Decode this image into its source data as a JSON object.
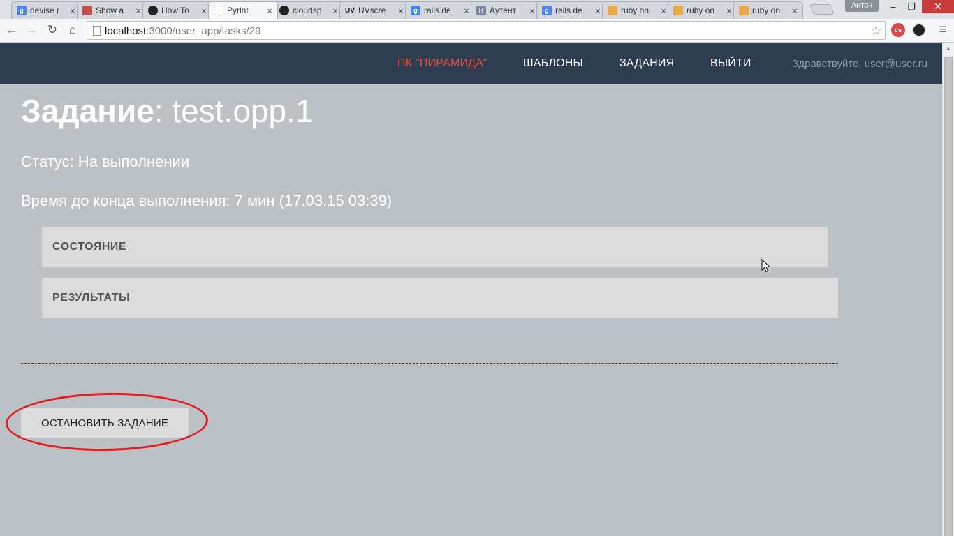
{
  "browser": {
    "tabs": [
      {
        "title": "devise r",
        "favicon": "google-icon",
        "color": "#4a86e8",
        "glyph": "g"
      },
      {
        "title": "Show a",
        "favicon": "image-icon",
        "color": "#c0504d",
        "glyph": ""
      },
      {
        "title": "How To",
        "favicon": "github-icon",
        "color": "#222222",
        "glyph": ""
      },
      {
        "title": "Pyrlnt",
        "favicon": "document-icon",
        "color": "#ffffff",
        "glyph": "",
        "active": true
      },
      {
        "title": "cloudsp",
        "favicon": "github-icon",
        "color": "#222222",
        "glyph": ""
      },
      {
        "title": "UVscre",
        "favicon": "uv-icon",
        "color": "#333333",
        "glyph": "UV"
      },
      {
        "title": "rails de",
        "favicon": "google-icon",
        "color": "#4a86e8",
        "glyph": "g"
      },
      {
        "title": "Аутент",
        "favicon": "habr-icon",
        "color": "#7b8aa0",
        "glyph": "H"
      },
      {
        "title": "rails de",
        "favicon": "google-icon",
        "color": "#4a86e8",
        "glyph": "g"
      },
      {
        "title": "ruby on",
        "favicon": "stackoverflow-icon",
        "color": "#e8a94a",
        "glyph": ""
      },
      {
        "title": "ruby on",
        "favicon": "stackoverflow-icon",
        "color": "#e8a94a",
        "glyph": ""
      },
      {
        "title": "ruby on",
        "favicon": "stackoverflow-icon",
        "color": "#e8a94a",
        "glyph": ""
      }
    ],
    "profile_name": "Антон",
    "url_host": "localhost",
    "url_path": ":3000/user_app/tasks/29",
    "window_buttons": {
      "minimize": "–",
      "restore": "❐",
      "close": "✕"
    }
  },
  "header": {
    "brand": "ПК \"ПИРАМИДА\"",
    "nav_templates": "ШАБЛОНЫ",
    "nav_tasks": "ЗАДАНИЯ",
    "nav_logout": "ВЫЙТИ",
    "greeting": "Здравствуйте, user@user.ru",
    "colors": {
      "background": "#2c3e50",
      "brand": "#e74c3c",
      "greeting": "#8d99a6"
    }
  },
  "task": {
    "title_label": "Задание",
    "title_value": ": test.opp.1",
    "status": "Статус: На выполнении",
    "deadline": "Время до конца выполнения: 7 мин (17.03.15 03:39)"
  },
  "panels": {
    "state": "СОСТОЯНИЕ",
    "results": "РЕЗУЛЬТАТЫ"
  },
  "actions": {
    "stop_button": "ОСТАНОВИТЬ ЗАДАНИЕ"
  },
  "annotation": {
    "color": "#e01f25",
    "shape": "ellipse"
  }
}
